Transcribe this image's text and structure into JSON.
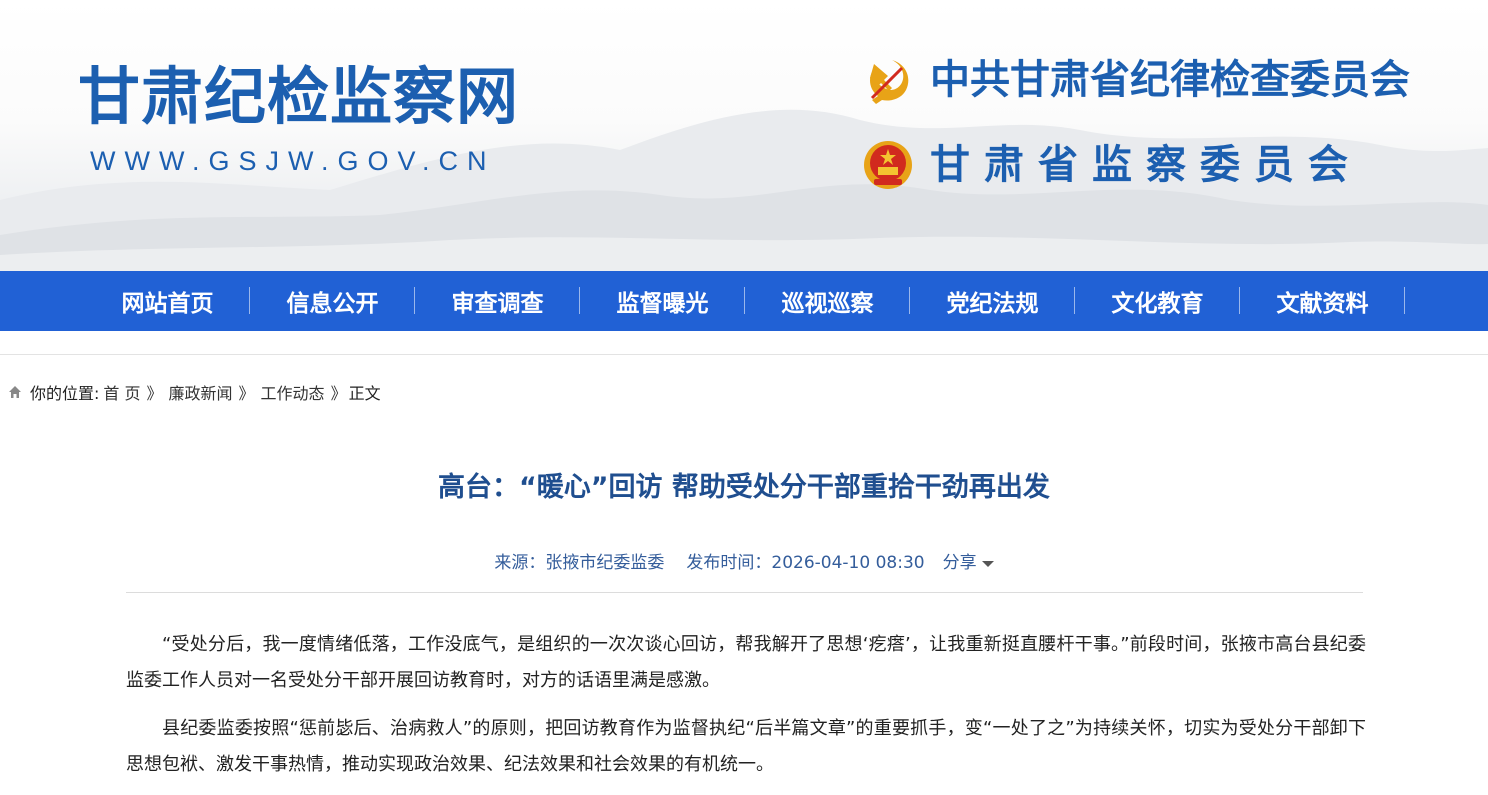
{
  "header": {
    "site_title": "甘肃纪检监察网",
    "site_url": "WWW.GSJW.GOV.CN",
    "org_party": "中共甘肃省纪律检查委员会",
    "org_state": "甘肃省监察委员会",
    "party_emblem_icon": "party-emblem-icon",
    "national_emblem_icon": "national-emblem-icon"
  },
  "nav": {
    "items": [
      "网站首页",
      "信息公开",
      "审查调查",
      "监督曝光",
      "巡视巡察",
      "党纪法规",
      "文化教育",
      "文献资料"
    ],
    "background": "#2161d5"
  },
  "breadcrumb": {
    "home_icon": "home-icon",
    "label": "你的位置:",
    "items": [
      "首 页",
      "廉政新闻",
      "工作动态",
      "正文"
    ],
    "separator": "》"
  },
  "article": {
    "title": "高台：“暖心”回访 帮助受处分干部重拾干劲再出发",
    "source": "来源：张掖市纪委监委",
    "publish_time": "发布时间：2026-04-10 08:30",
    "share_label": "分享",
    "paragraphs": [
      "“受处分后，我一度情绪低落，工作没底气，是组织的一次次谈心回访，帮我解开了思想‘疙瘩’，让我重新挺直腰杆干事。”前段时间，张掖市高台县纪委监委工作人员对一名受处分干部开展回访教育时，对方的话语里满是感激。",
      "县纪委监委按照“惩前毖后、治病救人”的原则，把回访教育作为监督执纪“后半篇文章”的重要抓手，变“一处了之”为持续关怀，切实为受处分干部卸下思想包袱、激发干事热情，推动实现政治效果、纪法效果和社会效果的有机统一。"
    ]
  },
  "colors": {
    "brand_blue": "#1c5fb0",
    "title_blue": "#1f4e8f",
    "meta_blue": "#345d9b"
  }
}
